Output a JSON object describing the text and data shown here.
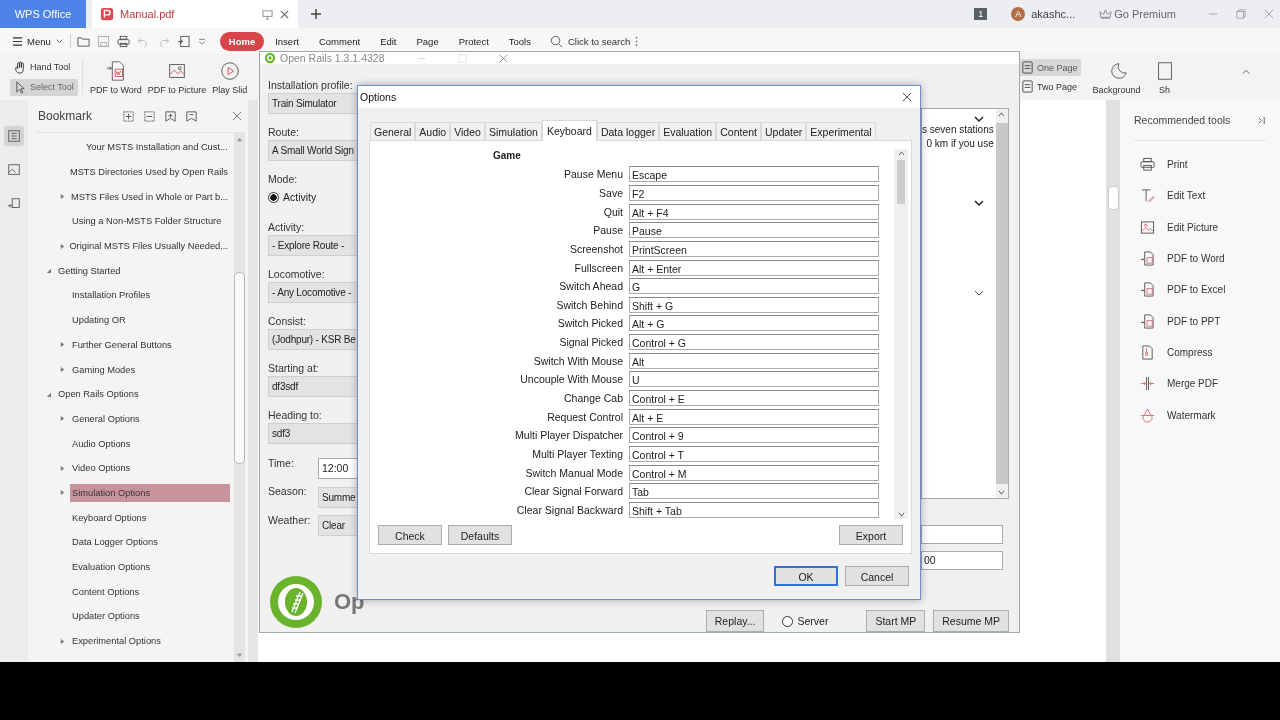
{
  "app_tabs": [
    {
      "label": "WPS Office",
      "kind": "home",
      "selected": false
    },
    {
      "label": "Manual.pdf",
      "kind": "document",
      "selected": true
    }
  ],
  "account": {
    "badge": "1",
    "avatar": "A",
    "name": "akashc...",
    "premium": "Go Premium"
  },
  "menu": {
    "label": "Menu"
  },
  "ribbon_tabs": [
    {
      "label": "Home",
      "selected": true
    },
    {
      "label": "Insert",
      "selected": false
    },
    {
      "label": "Comment",
      "selected": false
    },
    {
      "label": "Edit",
      "selected": false
    },
    {
      "label": "Page",
      "selected": false
    },
    {
      "label": "Protect",
      "selected": false
    },
    {
      "label": "Tools",
      "selected": false
    }
  ],
  "search": {
    "placeholder": "Click to search"
  },
  "cursor_tools": [
    {
      "label": "Hand Tool",
      "selected": false
    },
    {
      "label": "Select Tool",
      "selected": true
    }
  ],
  "big_tools": [
    {
      "label": "PDF to Word",
      "kind": "word"
    },
    {
      "label": "PDF to Picture",
      "kind": "picture"
    },
    {
      "label": "Play Slid",
      "kind": "play"
    }
  ],
  "view_tools": [
    {
      "label": "One Page",
      "selected": true
    },
    {
      "label": "Two Page",
      "selected": false
    }
  ],
  "background_tool": {
    "label": "Background"
  },
  "cut_tool": {
    "label": "Sh"
  },
  "bookmark": {
    "title": "Bookmark",
    "items": [
      {
        "children": [
          {
            "children": [
              {
                "label": "Your MSTS Installation and Cust...",
                "selected": false
              }
            ]
          },
          {
            "label": "MSTS Directories Used by Open Rails",
            "selected": false
          },
          {
            "label": "MSTS Files Used in Whole or Part b...",
            "expanded": false,
            "selected": false
          },
          {
            "label": "Using a Non-MSTS Folder Structure",
            "selected": false
          },
          {
            "label": "Original MSTS Files Usually Needed...",
            "expanded": false,
            "selected": false
          }
        ]
      },
      {
        "label": "Getting Started",
        "expanded": true,
        "selected": false,
        "children": [
          {
            "label": "Installation Profiles",
            "selected": false
          },
          {
            "label": "Updating OR",
            "selected": false
          },
          {
            "label": "Further General Buttons",
            "expanded": false,
            "selected": false
          },
          {
            "label": "Gaming Modes",
            "expanded": false,
            "selected": false
          }
        ]
      },
      {
        "label": "Open Rails Options",
        "expanded": true,
        "selected": false,
        "children": [
          {
            "label": "General Options",
            "expanded": false,
            "selected": false
          },
          {
            "label": "Audio Options",
            "selected": false
          },
          {
            "label": "Video Options",
            "expanded": false,
            "selected": false
          },
          {
            "label": "Simulation Options",
            "expanded": false,
            "selected": true
          },
          {
            "label": "Keyboard Options",
            "selected": false
          },
          {
            "label": "Data Logger Options",
            "selected": false
          },
          {
            "label": "Evaluation Options",
            "selected": false
          },
          {
            "label": "Content Options",
            "selected": false
          },
          {
            "label": "Updater Options",
            "selected": false
          },
          {
            "label": "Experimental Options",
            "expanded": false,
            "selected": false
          }
        ]
      }
    ]
  },
  "open_rails": {
    "title": "Open Rails 1.3.1.4328",
    "form": [
      {
        "label": "Installation profile:",
        "kind": "dropdown",
        "value": "Train Simulator"
      },
      {
        "label": "Route:",
        "kind": "dropdown",
        "value": "A Small World Sign"
      },
      {
        "label": "Mode:",
        "kind": "radio",
        "value": "Activity",
        "checked": true
      },
      {
        "label": "Activity:",
        "kind": "dropdown",
        "value": "- Explore Route -"
      },
      {
        "label": "Locomotive:",
        "kind": "dropdown",
        "value": "- Any Locomotive -"
      },
      {
        "label": "Consist:",
        "kind": "dropdown",
        "value": "(Jodhpur) - KSR Be"
      },
      {
        "label": "Starting at:",
        "kind": "dropdown",
        "value": "df3sdf"
      },
      {
        "label": "Heading to:",
        "kind": "dropdown",
        "value": "sdf3"
      },
      {
        "label": "Time:",
        "kind": "inline-text",
        "value": "12:00"
      },
      {
        "label": "Season:",
        "kind": "inline-dropdown",
        "value": "Summe"
      },
      {
        "label": "Weather:",
        "kind": "inline-dropdown",
        "value": "Clear"
      }
    ],
    "details": [
      "s seven stations",
      "0 km if you use"
    ],
    "side_fields": [
      {
        "kind": "text"
      },
      {
        "kind": "text",
        "value": "00"
      }
    ],
    "logo_text": "Op",
    "buttons": [
      {
        "label": "Replay...",
        "kind": "button"
      },
      {
        "label": "Server",
        "kind": "radio",
        "checked": false
      },
      {
        "label": "Start MP",
        "kind": "button"
      },
      {
        "label": "Resume MP",
        "kind": "button"
      }
    ]
  },
  "options": {
    "title": "Options",
    "tabs": [
      {
        "label": "General",
        "selected": false
      },
      {
        "label": "Audio",
        "selected": false
      },
      {
        "label": "Video",
        "selected": false
      },
      {
        "label": "Simulation",
        "selected": false
      },
      {
        "label": "Keyboard",
        "selected": true
      },
      {
        "label": "Data logger",
        "selected": false
      },
      {
        "label": "Evaluation",
        "selected": false
      },
      {
        "label": "Content",
        "selected": false
      },
      {
        "label": "Updater",
        "selected": false
      },
      {
        "label": "Experimental",
        "selected": false
      }
    ],
    "section": "Game",
    "bindings": [
      {
        "action": "Pause Menu",
        "key": "Escape"
      },
      {
        "action": "Save",
        "key": "F2"
      },
      {
        "action": "Quit",
        "key": "Alt + F4"
      },
      {
        "action": "Pause",
        "key": "Pause"
      },
      {
        "action": "Screenshot",
        "key": "PrintScreen"
      },
      {
        "action": "Fullscreen",
        "key": "Alt + Enter"
      },
      {
        "action": "Switch Ahead",
        "key": "G"
      },
      {
        "action": "Switch Behind",
        "key": "Shift + G"
      },
      {
        "action": "Switch Picked",
        "key": "Alt + G"
      },
      {
        "action": "Signal Picked",
        "key": "Control + G"
      },
      {
        "action": "Switch With Mouse",
        "key": "Alt"
      },
      {
        "action": "Uncouple With Mouse",
        "key": "U"
      },
      {
        "action": "Change Cab",
        "key": "Control + E"
      },
      {
        "action": "Request Control",
        "key": "Alt + E"
      },
      {
        "action": "Multi Player Dispatcher",
        "key": "Control + 9"
      },
      {
        "action": "Multi Player Texting",
        "key": "Control + T"
      },
      {
        "action": "Switch Manual Mode",
        "key": "Control + M"
      },
      {
        "action": "Clear Signal Forward",
        "key": "Tab"
      },
      {
        "action": "Clear Signal Backward",
        "key": "Shift + Tab"
      }
    ],
    "left_buttons": [
      "Check",
      "Defaults"
    ],
    "right_button": "Export",
    "ok": "OK",
    "cancel": "Cancel"
  },
  "recommended": {
    "title": "Recommended tools",
    "items": [
      {
        "label": "Print",
        "kind": "print"
      },
      {
        "label": "Edit Text",
        "kind": "text"
      },
      {
        "label": "Edit Picture",
        "kind": "picture"
      },
      {
        "label": "PDF to Word",
        "kind": "word"
      },
      {
        "label": "PDF to Excel",
        "kind": "excel"
      },
      {
        "label": "PDF to PPT",
        "kind": "ppt"
      },
      {
        "label": "Compress",
        "kind": "compress"
      },
      {
        "label": "Merge PDF",
        "kind": "merge"
      },
      {
        "label": "Watermark",
        "kind": "watermark"
      }
    ]
  }
}
